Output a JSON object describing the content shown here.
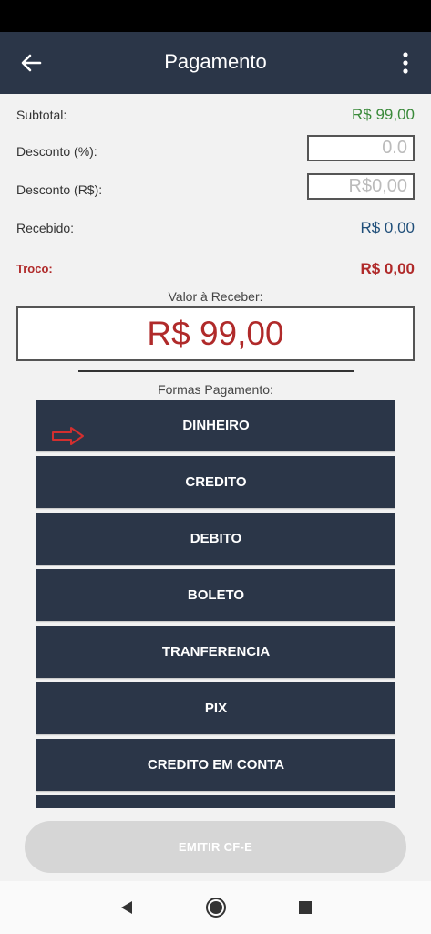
{
  "header": {
    "title": "Pagamento"
  },
  "summary": {
    "subtotal_label": "Subtotal:",
    "subtotal_value": "R$ 99,00",
    "desconto_pct_label": "Desconto (%):",
    "desconto_pct_placeholder": "0.0",
    "desconto_rs_label": "Desconto (R$):",
    "desconto_rs_placeholder": "R$0,00",
    "recebido_label": "Recebido:",
    "recebido_value": "R$ 0,00",
    "troco_label": "Troco:",
    "troco_value": "R$ 0,00"
  },
  "receber": {
    "label": "Valor à Receber:",
    "value": "R$ 99,00"
  },
  "formas": {
    "label": "Formas Pagamento:",
    "items": [
      {
        "label": "DINHEIRO",
        "selected": true
      },
      {
        "label": "CREDITO"
      },
      {
        "label": "DEBITO"
      },
      {
        "label": "BOLETO"
      },
      {
        "label": "TRANFERENCIA"
      },
      {
        "label": "PIX"
      },
      {
        "label": "CREDITO EM CONTA"
      },
      {
        "label": ""
      }
    ]
  },
  "footer": {
    "emit_label": "EMITIR CF-E"
  },
  "colors": {
    "bar": "#2b3648",
    "green": "#3a8a3a",
    "blue": "#1f4e79",
    "red": "#b02a2a",
    "arrow": "#d32f2f"
  },
  "icons": {
    "back": "back-arrow-icon",
    "more": "more-vert-icon",
    "selected": "arrow-right-outline-icon",
    "nav_back": "triangle-back-icon",
    "nav_home": "circle-home-icon",
    "nav_recent": "square-recent-icon"
  }
}
